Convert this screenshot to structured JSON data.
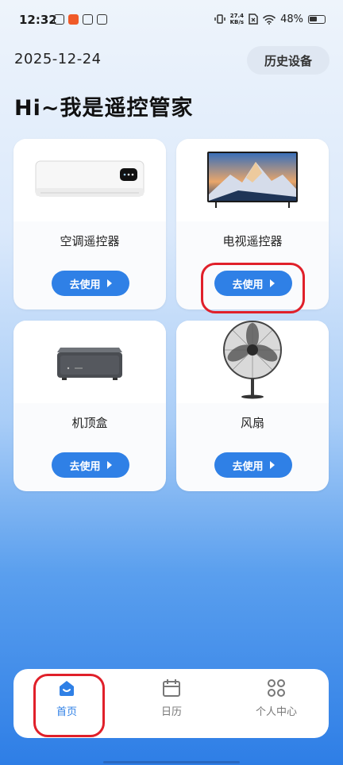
{
  "status_bar": {
    "time": "12:32",
    "net_speed_value": "27.4",
    "net_speed_unit": "KB/s",
    "battery": "48%"
  },
  "header": {
    "date": "2025-12-24",
    "history_button": "历史设备",
    "greeting": "Hi~我是遥控管家"
  },
  "devices": [
    {
      "name": "空调遥控器",
      "button": "去使用",
      "icon": "air-conditioner-icon"
    },
    {
      "name": "电视遥控器",
      "button": "去使用",
      "icon": "tv-icon"
    },
    {
      "name": "机顶盒",
      "button": "去使用",
      "icon": "set-top-box-icon"
    },
    {
      "name": "风扇",
      "button": "去使用",
      "icon": "fan-icon"
    }
  ],
  "tabbar": {
    "items": [
      {
        "label": "首页",
        "icon": "home-icon",
        "active": true
      },
      {
        "label": "日历",
        "icon": "calendar-icon",
        "active": false
      },
      {
        "label": "个人中心",
        "icon": "profile-grid-icon",
        "active": false
      }
    ]
  },
  "colors": {
    "accent": "#2f80e6",
    "annotation": "#e0202a"
  }
}
